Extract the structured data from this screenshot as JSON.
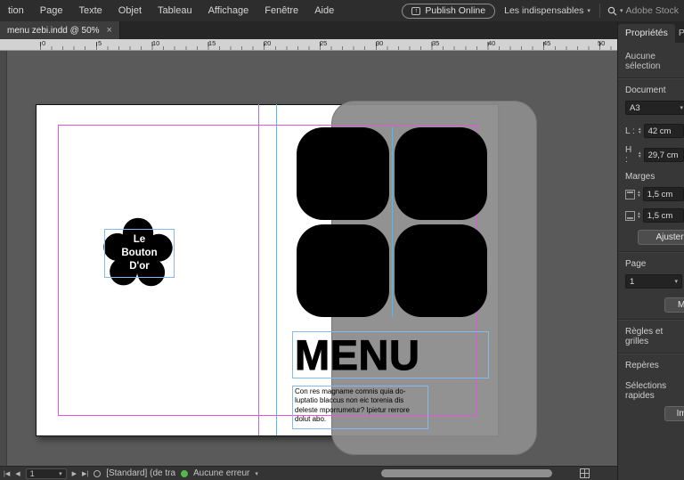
{
  "icons": {
    "close": "×",
    "chevron_down": "▾",
    "upload_arrow": "↑",
    "first_page": "|◀",
    "prev_page": "◀",
    "next_page": "▶",
    "last_page": "▶|",
    "stepper_up": "▴",
    "stepper_down": "▾"
  },
  "colors": {
    "margin_guide": "#e454dc",
    "column_guide": "#ae6fe2",
    "ruler_guide": "#4bbdf2",
    "frame_edge": "#85b9ee",
    "success_green": "#55b84c"
  },
  "menubar": {
    "items": [
      "tion",
      "Page",
      "Texte",
      "Objet",
      "Tableau",
      "Affichage",
      "Fenêtre",
      "Aide"
    ],
    "publish_label": "Publish Online",
    "workspace_label": "Les indispensables",
    "search_label": "Adobe Stock"
  },
  "tabbar": {
    "document_tab": "menu zebi.indd @ 50%"
  },
  "ruler": {
    "ticks": [
      "0",
      "5",
      "10",
      "15",
      "20",
      "25",
      "30",
      "35",
      "40",
      "45",
      "50"
    ]
  },
  "document": {
    "logo_line1": "Le",
    "logo_line2": "Bouton",
    "logo_line3": "D'or",
    "menu_title": "MENU",
    "body_text": "Con res magname comnis quia do-luptatio blaccus non eic torenia dis deleste mporrumetur? Ipietur rerrore dolut abo."
  },
  "panel": {
    "tab_properties": "Propriétés",
    "tab_pages": "P",
    "no_selection": "Aucune sélection",
    "section_document": "Document",
    "page_size": "A3",
    "width_label": "L :",
    "width_value": "42 cm",
    "height_label": "H :",
    "height_value": "29,7 cm",
    "section_margins": "Marges",
    "margin_top_value": "1,5 cm",
    "margin_bottom_value": "1,5 cm",
    "adjust_button": "Ajuster",
    "section_page": "Page",
    "page_number": "1",
    "mode_button": "Mo",
    "section_rules": "Règles et grilles",
    "section_guides": "Repères",
    "section_quick": "Sélections rapides",
    "import_button": "Imp"
  },
  "statusbar": {
    "page_value": "1",
    "preflight_profile": "[Standard] (de tra",
    "status_ok": "Aucune erreur"
  }
}
